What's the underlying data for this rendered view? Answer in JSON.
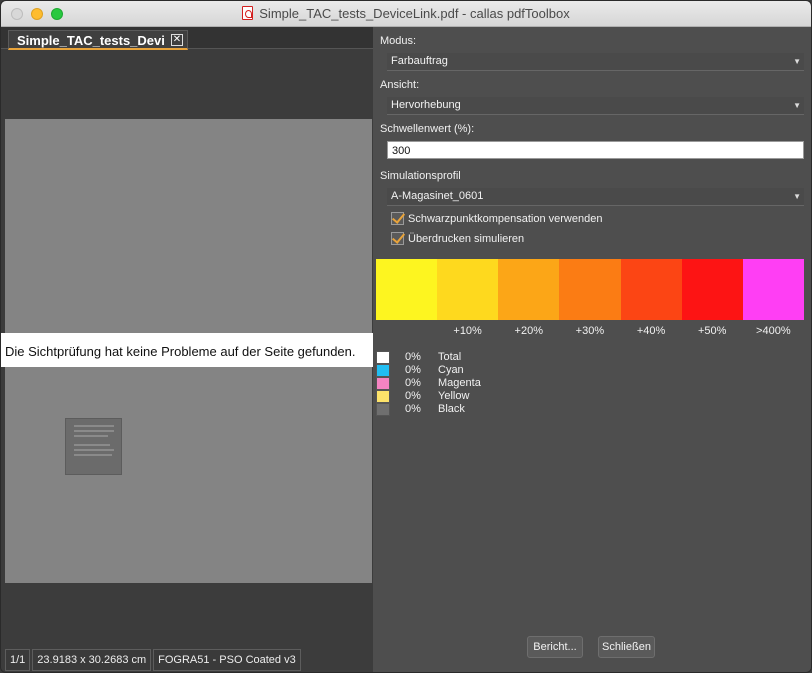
{
  "window": {
    "title": "Simple_TAC_tests_DeviceLink.pdf - callas pdfToolbox"
  },
  "left_pane": {
    "tab_label": "Simple_TAC_tests_Devi",
    "message": "Die Sichtprüfung hat keine Probleme auf der Seite gefunden.",
    "status": {
      "page": "1/1",
      "dimensions": "23.9183 x 30.2683 cm",
      "profile": "FOGRA51 - PSO Coated v3"
    }
  },
  "settings": {
    "modus_label": "Modus:",
    "modus_value": "Farbauftrag",
    "ansicht_label": "Ansicht:",
    "ansicht_value": "Hervorhebung",
    "threshold_label": "Schwellenwert (%):",
    "threshold_value": "300",
    "simulation_label": "Simulationsprofil",
    "simulation_value": "A-Magasinet_0601",
    "blackpoint_label": "Schwarzpunktkompensation verwenden",
    "blackpoint_checked": true,
    "overprint_label": "Überdrucken simulieren",
    "overprint_checked": true
  },
  "scale": {
    "colors": [
      "#fdf520",
      "#fed91e",
      "#fca617",
      "#fb7c14",
      "#fc4514",
      "#fd1414",
      "#ff3ef4"
    ],
    "labels": [
      "+10%",
      "+20%",
      "+30%",
      "+40%",
      "+50%",
      ">400%"
    ]
  },
  "legend": [
    {
      "color": "#ffffff",
      "value": "0%",
      "name": "Total"
    },
    {
      "color": "#21bef2",
      "value": "0%",
      "name": "Cyan"
    },
    {
      "color": "#f584c2",
      "value": "0%",
      "name": "Magenta"
    },
    {
      "color": "#fde36a",
      "value": "0%",
      "name": "Yellow"
    },
    {
      "color": "#6f6f6f",
      "value": "0%",
      "name": "Black"
    }
  ],
  "buttons": {
    "report": "Bericht...",
    "close": "Schließen"
  }
}
